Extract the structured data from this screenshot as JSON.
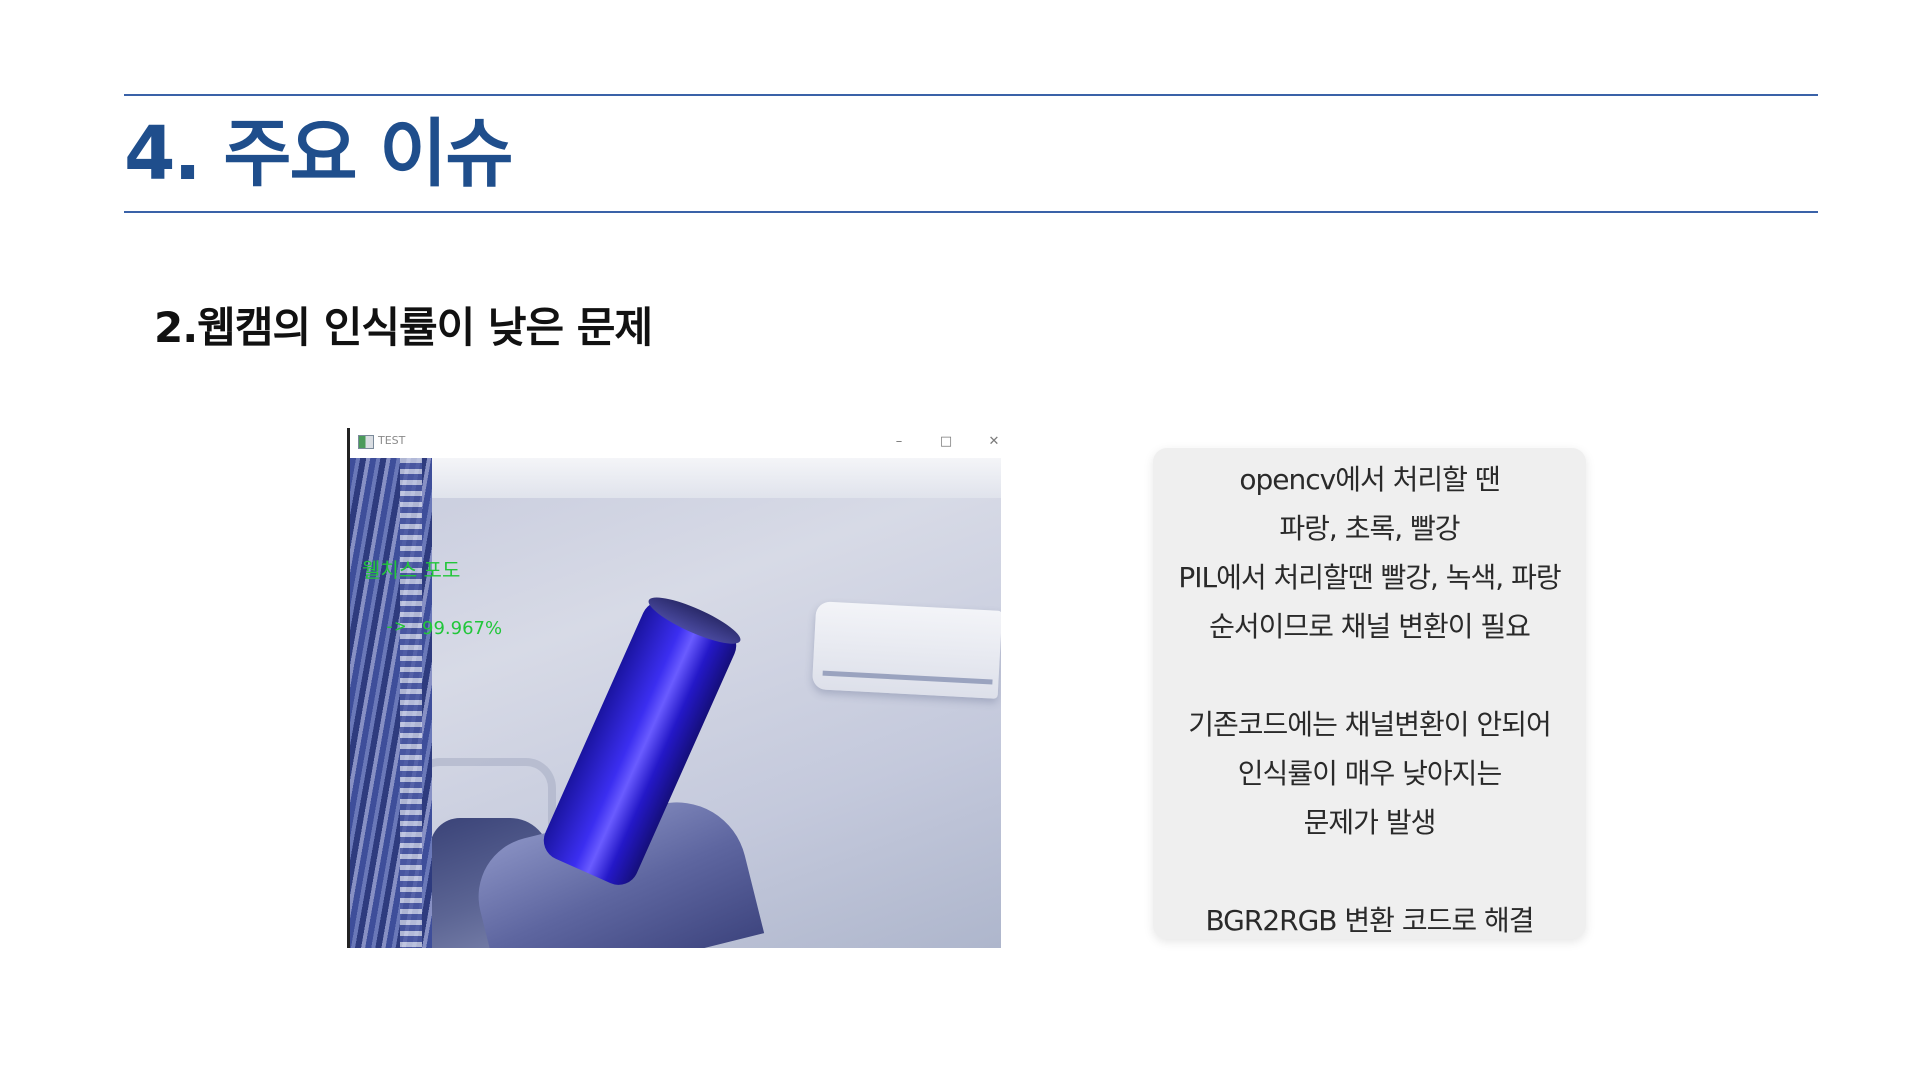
{
  "slide": {
    "title": "4. 주요 이슈",
    "section_heading": "2.웹캠의 인식률이 낮은 문제"
  },
  "webcam_window": {
    "title": "TEST",
    "controls": {
      "minimize": "–",
      "maximize": "□",
      "close": "✕"
    },
    "overlay": {
      "label": "웰치스 포도",
      "arrow": "->",
      "probability": "99.967%"
    },
    "overlay_color": "#22c63a"
  },
  "note": {
    "lines": [
      "opencv에서 처리할 땐",
      "파랑, 초록, 빨강",
      "PIL에서 처리할땐 빨강, 녹색, 파랑",
      "순서이므로 채널 변환이 필요",
      "",
      "기존코드에는 채널변환이 안되어",
      "인식률이 매우 낮아지는",
      "문제가 발생",
      "",
      "BGR2RGB 변환 코드로 해결"
    ]
  },
  "colors": {
    "title": "#1f4e8c",
    "rule": "#3a62a8",
    "note_background": "#efefef"
  }
}
